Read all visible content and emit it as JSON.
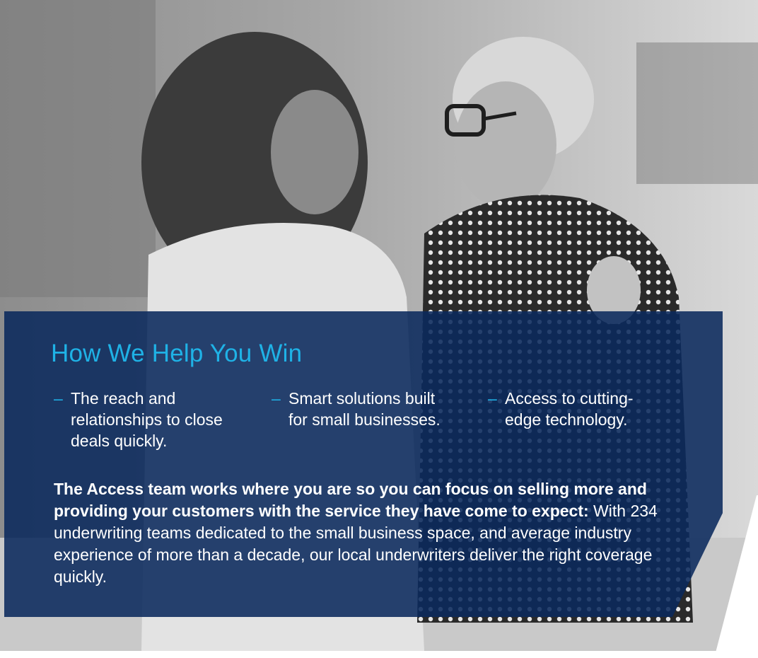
{
  "hero": {
    "image_alt": "Two women laughing while walking outdoors",
    "tone": "grayscale"
  },
  "panel": {
    "heading": "How We Help You Win",
    "bullets": [
      {
        "dash": "–",
        "text": "The reach and relationships to close deals quickly."
      },
      {
        "dash": "–",
        "text": "Smart solutions built for small businesses."
      },
      {
        "dash": "–",
        "text": "Access to cutting-edge technology."
      }
    ],
    "body_bold": "The Access team works where you are so you can focus on selling more and providing your customers with the service they have come to expect:",
    "body_rest": " With 234 underwriting teams dedicated to the small business space, and average industry experience of more than a decade, our local underwriters deliver the right coverage quickly."
  },
  "colors": {
    "panel_bg": "#0a295c",
    "heading": "#1fb2e6",
    "dash": "#1fb2e6",
    "body_text": "#ffffff"
  }
}
